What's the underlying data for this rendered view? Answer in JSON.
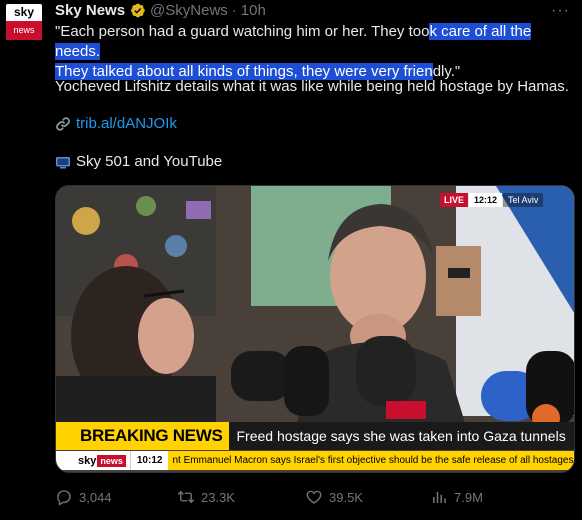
{
  "account": {
    "avatar_top": "sky",
    "avatar_bottom": "news",
    "name": "Sky News",
    "handle": "@SkyNews",
    "separator": "·",
    "time": "10h",
    "more": "···"
  },
  "tweet": {
    "quote_plain": "\"Each person had a guard watching him or her. They too",
    "quote_highlight_1": "k care of all the needs.",
    "quote_highlight_2": "They talked about all kinds of things, they were very frien",
    "quote_tail": "dly.\"",
    "paragraph": "Yocheved Lifshitz details what it was like while being held hostage by Hamas.",
    "link": "trib.al/dANJOIk",
    "tv_line": "Sky 501 and YouTube"
  },
  "media": {
    "live": "LIVE",
    "clock": "12:12",
    "city": "Tel Aviv",
    "breaking_label": "BREAKING NEWS",
    "breaking_headline": "Freed hostage says she was taken into Gaza tunnels",
    "ticker_sky": "sky",
    "ticker_news": "news",
    "ticker_time": "10:12",
    "ticker_text": "nt Emmanuel Macron says Israel's first objective should be the safe release of all hostages"
  },
  "actions": {
    "replies": "3,044",
    "reposts": "23.3K",
    "likes": "39.5K",
    "views": "7.9M"
  },
  "colors": {
    "link": "#1d9bf0",
    "highlight": "#1c4fd6",
    "breaking_yellow": "#ffd200",
    "sky_red": "#c8102e"
  },
  "icons": [
    "verified-icon",
    "link-icon",
    "tv-icon",
    "reply-icon",
    "repost-icon",
    "like-icon",
    "views-icon",
    "more-icon"
  ]
}
